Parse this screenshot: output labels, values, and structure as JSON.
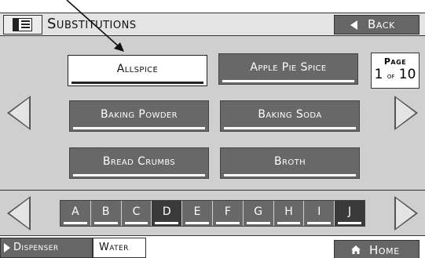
{
  "header": {
    "title": "Substitutions",
    "back_label": "Back"
  },
  "items": [
    {
      "label": "Allspice",
      "selected": true
    },
    {
      "label": "Apple Pie Spice",
      "selected": false
    },
    {
      "label": "Baking Powder",
      "selected": false
    },
    {
      "label": "Baking Soda",
      "selected": false
    },
    {
      "label": "Bread Crumbs",
      "selected": false
    },
    {
      "label": "Broth",
      "selected": false
    }
  ],
  "page": {
    "label": "Page",
    "current": "1",
    "of": "of",
    "total": "10"
  },
  "letters": [
    "A",
    "B",
    "C",
    "D",
    "E",
    "F",
    "G",
    "H",
    "I",
    "J"
  ],
  "letters_dark": [
    "D",
    "J"
  ],
  "bottom": {
    "dispenser_label": "Dispenser",
    "water_label": "Water",
    "home_label": "Home"
  },
  "colors": {
    "button_gray": "#686868",
    "panel_gray": "#cfcfcf",
    "header_gray": "#e4e4e4"
  }
}
